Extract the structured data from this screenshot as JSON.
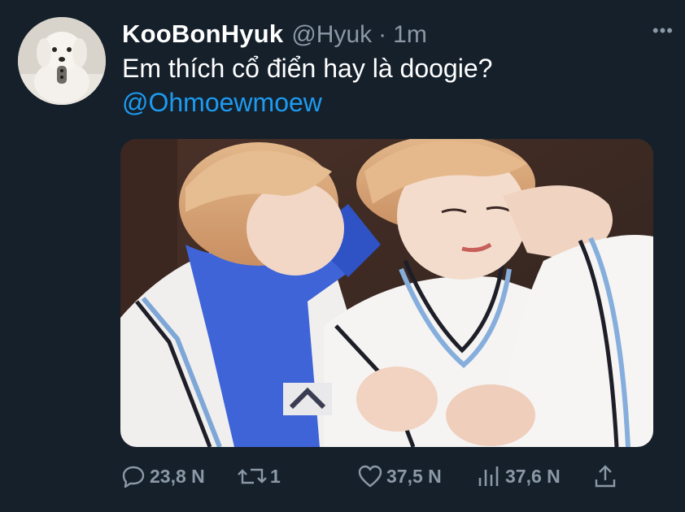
{
  "tweet": {
    "display_name": "KooBonHyuk",
    "handle": "@Hyuk",
    "separator": "·",
    "time": "1m",
    "more_label": "•••",
    "text": "Em thích cổ điển hay là doogie?",
    "mention": "@Ohmoewmoew"
  },
  "actions": {
    "reply_count": "23,8 N",
    "retweet_count": "1",
    "like_count": "37,5 N",
    "views_count": "37,6 N"
  },
  "icons": {
    "reply": "speech-bubble-icon",
    "retweet": "retweet-arrows-icon",
    "like": "heart-icon",
    "views": "bar-chart-icon",
    "share": "share-upload-icon",
    "more": "more-dots-icon"
  },
  "colors": {
    "background": "#15202b",
    "text": "#ffffff",
    "secondary": "#8b98a5",
    "link": "#1d9bf0"
  }
}
